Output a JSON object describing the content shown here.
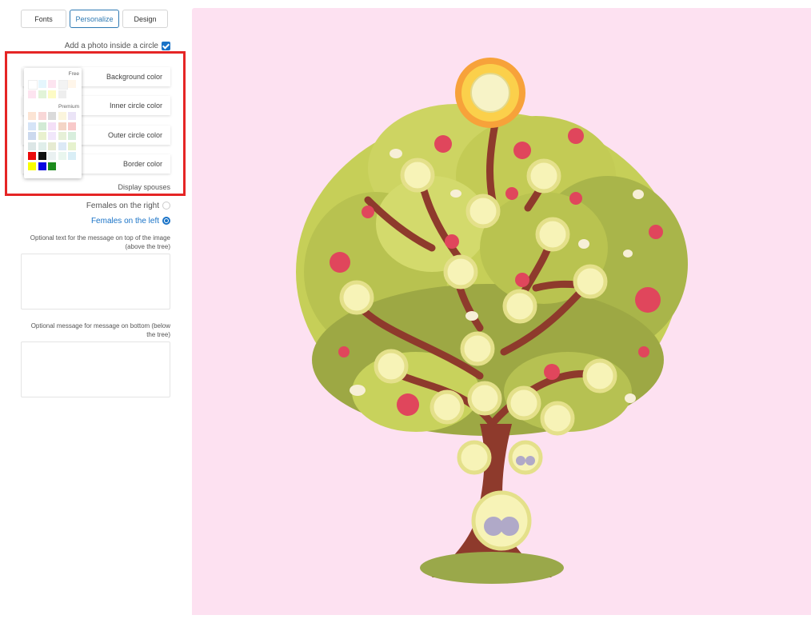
{
  "tabs": [
    {
      "label": "Fonts"
    },
    {
      "label": "Personalize"
    },
    {
      "label": "Design"
    }
  ],
  "photo_option": {
    "label": "Add a photo inside a circle",
    "checked": true
  },
  "color_buttons": {
    "background": "Background color",
    "inner": "Inner circle color",
    "outer": "Outer circle color",
    "border": "Border color"
  },
  "palette": {
    "free_label": "Free",
    "premium_label": "Premium",
    "free_colors": [
      "#ffffff",
      "#e5f6fd",
      "#fde4f0",
      "#f3f3f3",
      "#fff6ea",
      "#fde4f0",
      "#e2f4d8",
      "#fdfbc5",
      "#eeeeee"
    ],
    "premium_colors": [
      "#fce4d4",
      "#f8d7d7",
      "#dadada",
      "#fbf5dd",
      "#ebe4f7",
      "#d5e4f7",
      "#d2ead5",
      "#f4dff7",
      "#f4d5c6",
      "#f8c9c9",
      "#ccd9ee",
      "#e9f1cf",
      "#f1e7fb",
      "#e6f0d8",
      "#d8eedd",
      "#dce6e6",
      "#e0eeea",
      "#e6ebd2",
      "#dce9f6",
      "#e6f2ce",
      "#ea0a0a",
      "#111111",
      "#eaf1f1",
      "#e9f6ee",
      "#d9eef6",
      "#f8ff00",
      "#0808e0",
      "#1d8b1d"
    ]
  },
  "display_spouses": "Display spouses",
  "females_right": "Females on the right",
  "females_left": "Females on the left",
  "top_message_label": "Optional text for the message on top of the image (above the tree)",
  "bottom_message_label": "Optional message for message on bottom (below the tree)",
  "colors": {
    "accent": "#1a73c7",
    "highlight": "#e52525",
    "canvas": "#fde1f1"
  }
}
